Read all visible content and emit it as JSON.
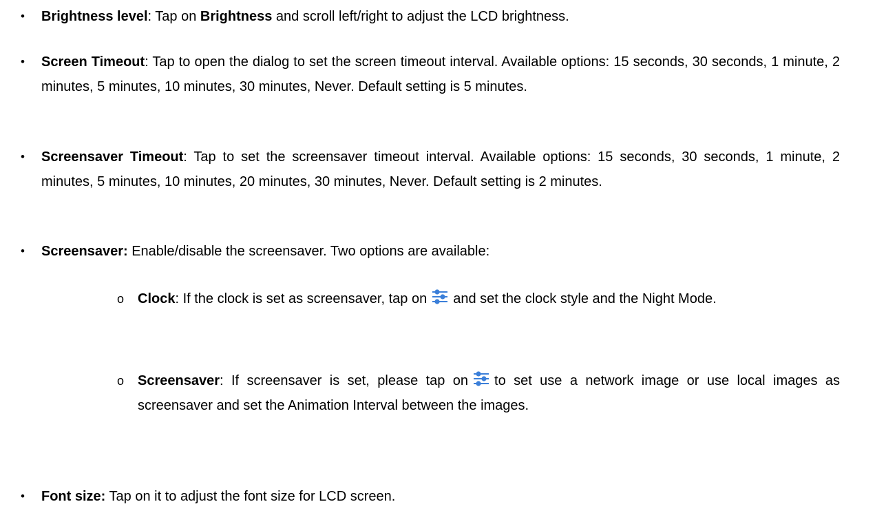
{
  "bullets": {
    "main": "•",
    "sub": "o"
  },
  "items": [
    {
      "term": "Brightness level",
      "sep": ": Tap on ",
      "term2": "Brightness",
      "rest": " and scroll left/right to adjust the LCD brightness."
    },
    {
      "term": "Screen Timeout",
      "rest": ": Tap to open the dialog to set the screen timeout interval. Available options: 15 seconds, 30 seconds, 1 minute, 2  minutes, 5 minutes, 10 minutes, 30 minutes, Never.  Default setting is 5 minutes."
    },
    {
      "term": "Screensaver Timeout",
      "rest": ": Tap to set the screensaver timeout interval. Available options: 15 seconds, 30 seconds, 1 minute, 2 minutes, 5 minutes, 10 minutes, 20 minutes, 30 minutes, Never. Default setting is 2 minutes."
    },
    {
      "term": "Screensaver:",
      "rest": " Enable/disable the screensaver. Two options are available:"
    },
    {
      "term": "Font size:",
      "rest": " Tap on it to adjust the font size for LCD screen."
    }
  ],
  "subitems": [
    {
      "term": "Clock",
      "before_icon": ": If the clock is set as screensaver, tap on",
      "after_icon": "and set the clock style and the Night Mode."
    },
    {
      "term": "Screensaver",
      "before_icon": ": If screensaver is set, please tap on",
      "after_icon": "to set use a network image or use local images as screensaver and set the Animation Interval between the images."
    }
  ],
  "icon": {
    "name": "settings-sliders-icon",
    "color": "#3b7fd9"
  }
}
